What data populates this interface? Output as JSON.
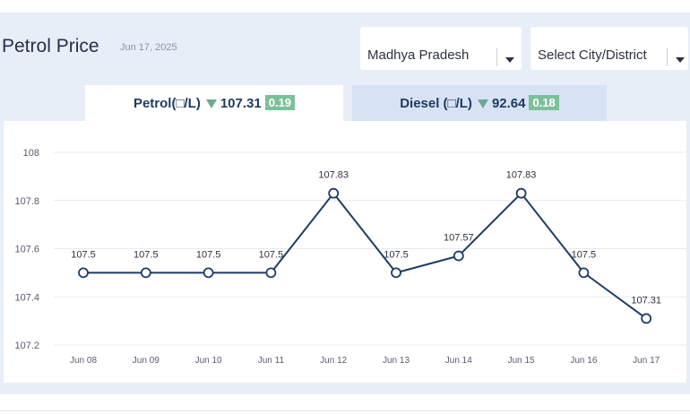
{
  "header": {
    "title": "Petrol Price",
    "date": "Jun 17, 2025"
  },
  "filters": {
    "state": "Madhya Pradesh",
    "city": "Select City/District"
  },
  "tabs": [
    {
      "label": "Petrol(□/L)",
      "price": "107.31",
      "change": "0.19",
      "trend": "down",
      "active": true
    },
    {
      "label": "Diesel (□/L)",
      "price": "92.64",
      "change": "0.18",
      "trend": "down",
      "active": false
    }
  ],
  "colors": {
    "line": "#1f3b63",
    "badge": "#7cc09a",
    "arrow": "#6aab8e"
  },
  "chart_data": {
    "type": "line",
    "categories": [
      "Jun 08",
      "Jun 09",
      "Jun 10",
      "Jun 11",
      "Jun 12",
      "Jun 13",
      "Jun 14",
      "Jun 15",
      "Jun 16",
      "Jun 17"
    ],
    "values": [
      107.5,
      107.5,
      107.5,
      107.5,
      107.83,
      107.5,
      107.57,
      107.83,
      107.5,
      107.31
    ],
    "data_labels": [
      "107.5",
      "107.5",
      "107.5",
      "107.5",
      "107.83",
      "107.5",
      "107.57",
      "107.83",
      "107.5",
      "107.31"
    ],
    "yticks": [
      108,
      107.8,
      107.6,
      107.4,
      107.2
    ],
    "ytick_labels": [
      "108",
      "107.8",
      "107.6",
      "107.4",
      "107.2"
    ],
    "ylim": [
      107.2,
      108
    ],
    "grid": true
  }
}
